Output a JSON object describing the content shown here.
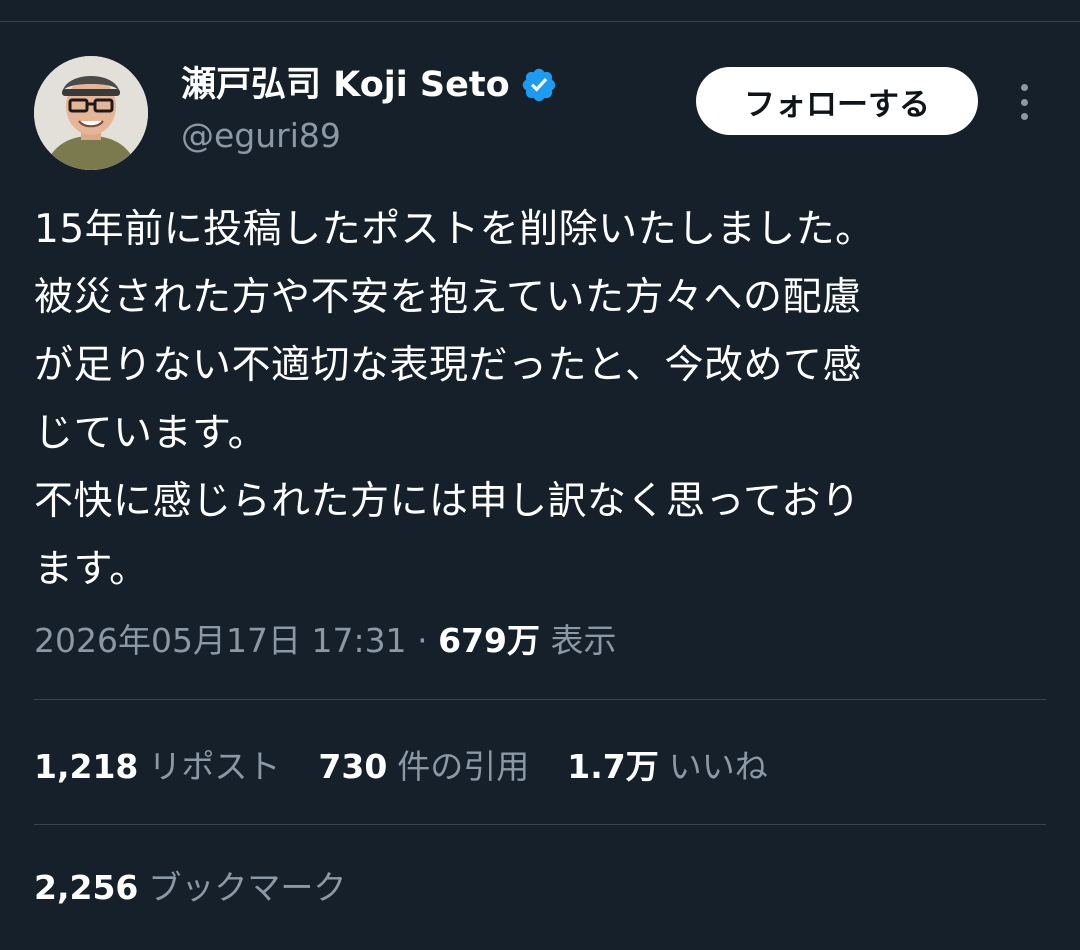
{
  "author": {
    "display_name": "瀬戸弘司 Koji Seto",
    "handle": "@eguri89",
    "verified": true
  },
  "follow_button_label": "フォローする",
  "tweet": {
    "lines": [
      "15年前に投稿したポストを削除いたしました。",
      "被災された方や不安を抱えていた方々への配慮",
      "が足りない不適切な表現だったと、今改めて感",
      "じています。",
      "不快に感じられた方には申し訳なく思っており",
      "ます。"
    ]
  },
  "meta": {
    "timestamp": "2026年05月17日 17:31",
    "separator": "·",
    "views_count": "679万",
    "views_label": "表示"
  },
  "stats": {
    "reposts": {
      "count": "1,218",
      "label": "リポスト"
    },
    "quotes": {
      "count": "730",
      "label": "件の引用"
    },
    "likes": {
      "count": "1.7万",
      "label": "いいね"
    },
    "bookmarks": {
      "count": "2,256",
      "label": "ブックマーク"
    }
  },
  "icons": {
    "verified": "verified-badge-icon",
    "more": "more-options-icon"
  },
  "colors": {
    "background": "#15202b",
    "text_primary": "#ffffff",
    "text_secondary": "#8b98a5",
    "divider": "#38444d",
    "verified_blue": "#1d9bf0",
    "follow_button_bg": "#ffffff",
    "follow_button_text": "#0f1419"
  }
}
